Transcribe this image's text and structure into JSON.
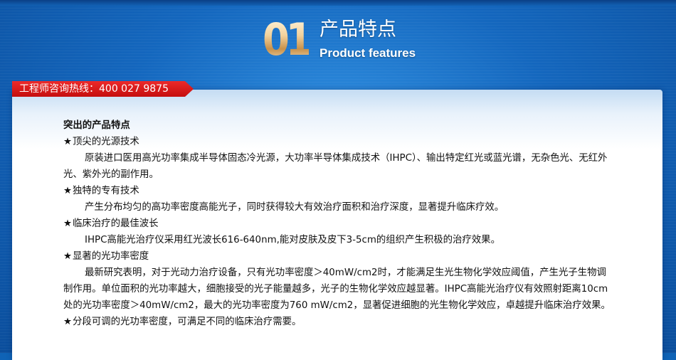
{
  "header": {
    "number": "01",
    "title_cn": "产品特点",
    "title_en": "Product features"
  },
  "hotline": {
    "text": "工程师咨询热线：400 027 9875"
  },
  "content": {
    "heading": "突出的产品特点",
    "sections": [
      {
        "star": "★",
        "title": "顶尖的光源技术",
        "body": "原装进口医用高光功率集成半导体固态冷光源，大功率半导体集成技术（IHPC）、输出特定红光或蓝光谱，无杂色光、无红外光、紫外光的副作用。"
      },
      {
        "star": "★",
        "title": "独特的专有技术",
        "body": "产生分布均匀的高功率密度高能光子，同时获得较大有效治疗面积和治疗深度，显著提升临床疗效。"
      },
      {
        "star": "★",
        "title": "临床治疗的最佳波长",
        "body": "IHPC高能光治疗仪采用红光波长616-640nm,能对皮肤及皮下3-5cm的组织产生积极的治疗效果。"
      },
      {
        "star": "★",
        "title": "显著的光功率密度",
        "body": "最新研究表明，对于光动力治疗设备，只有光功率密度＞40mW/cm2时，才能满足生光生物化学效应阈值，产生光子生物调制作用。单位面积的光功率越大，细胞接受的光子能量越多，光子的生物化学效应越显著。IHPC高能光治疗仪有效照射距离10cm处的光功率密度＞40mW/cm2，最大的光功率密度为760 mW/cm2，显著促进细胞的光生物化学效应，卓越提升临床治疗效果。"
      },
      {
        "star": "★",
        "title": "分段可调的光功率密度，可满足不同的临床治疗需要。",
        "body": ""
      }
    ]
  }
}
